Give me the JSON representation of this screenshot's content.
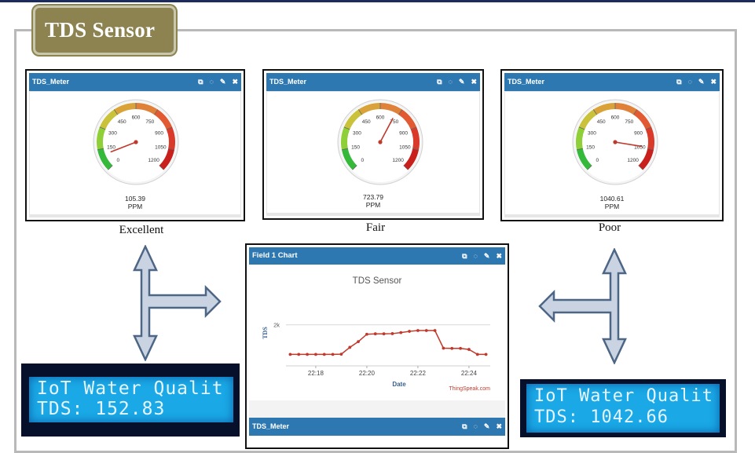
{
  "page": {
    "title": "TDS Sensor"
  },
  "gauge_widgets": [
    {
      "title": "TDS_Meter",
      "value": 105.39,
      "value_text": "105.39",
      "unit": "PPM",
      "caption": "Excellent"
    },
    {
      "title": "TDS_Meter",
      "value": 723.79,
      "value_text": "723.79",
      "unit": "PPM",
      "caption": "Fair"
    },
    {
      "title": "TDS_Meter",
      "value": 1040.61,
      "value_text": "1040.61",
      "unit": "PPM",
      "caption": "Poor"
    }
  ],
  "gauge_scale": {
    "min": 0,
    "max": 1200,
    "ticks": [
      "0",
      "150",
      "300",
      "450",
      "600",
      "750",
      "900",
      "1050",
      "1200"
    ]
  },
  "widget_icons": [
    "external-link-icon",
    "comment-icon",
    "pencil-icon",
    "close-icon"
  ],
  "widget_icon_glyphs": [
    "⧉",
    "◌",
    "✎",
    "✖"
  ],
  "chart_widget": {
    "title": "Field 1 Chart",
    "footer_title": "TDS_Meter",
    "watermark": "ThingSpeak.com"
  },
  "chart_data": {
    "type": "line",
    "title": "TDS Sensor",
    "xlabel": "Date",
    "ylabel": "TDS",
    "x_ticks": [
      "22:18",
      "22:20",
      "22:22",
      "22:24"
    ],
    "y_ticks": [
      "2k"
    ],
    "ylim": [
      0,
      2600
    ],
    "series": [
      {
        "color": "#c0392b",
        "x": [
          "22:17:00",
          "22:17:20",
          "22:17:40",
          "22:18:00",
          "22:18:20",
          "22:18:40",
          "22:19:00",
          "22:19:20",
          "22:19:40",
          "22:20:00",
          "22:20:20",
          "22:20:40",
          "22:21:00",
          "22:21:20",
          "22:21:40",
          "22:22:00",
          "22:22:20",
          "22:22:40",
          "22:23:00",
          "22:23:20",
          "22:23:40",
          "22:24:00",
          "22:24:20",
          "22:24:40"
        ],
        "values": [
          560,
          560,
          560,
          560,
          560,
          560,
          570,
          900,
          1180,
          1540,
          1560,
          1560,
          1570,
          1620,
          1680,
          1720,
          1720,
          1720,
          860,
          850,
          850,
          800,
          560,
          560
        ]
      }
    ]
  },
  "lcd_displays": [
    {
      "line1": "IoT Water Qualit",
      "line2": "TDS: 152.83"
    },
    {
      "line1": "IoT Water Qualit",
      "line2": "TDS: 1042.66"
    }
  ]
}
